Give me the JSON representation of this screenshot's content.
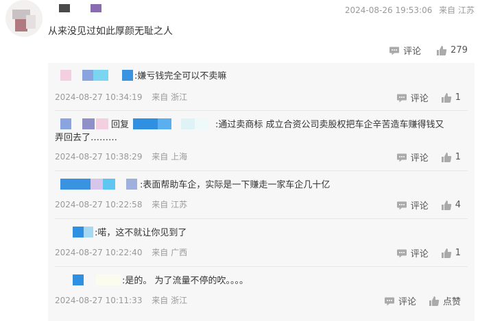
{
  "colors": {
    "text": "#333333",
    "meta": "#999999",
    "reply_bg": "#f7f7f7",
    "icon": "#aaaaaa"
  },
  "icons": {
    "comment": "comment-bubble-icon",
    "like": "thumbs-up-icon"
  },
  "main_comment": {
    "time": "2024-08-26 19:53:06",
    "location": "来自 江苏",
    "text": "从来没见过如此厚颜无耻之人",
    "comment_label": "评论",
    "like_count": "279"
  },
  "replies": [
    {
      "text": ":嫌亏钱完全可以不卖嘛",
      "time": "2024-08-27 10:34:19",
      "location": "来自 浙江",
      "comment_label": "评论",
      "like_count": "1"
    },
    {
      "reply_word": "回复",
      "text": ":通过卖商标 成立合资公司卖股权把车企辛苦造车赚得钱又",
      "text2": "弄回去了………",
      "time": "2024-08-27 10:38:29",
      "location": "来自 上海",
      "comment_label": "评论",
      "like_count": "1"
    },
    {
      "text": ":表面帮助车企，实际是一下赚走一家车企几十亿",
      "time": "2024-08-27 10:22:58",
      "location": "来自 江苏",
      "comment_label": "评论",
      "like_count": "4"
    },
    {
      "text": ":喏，这不就让你见到了",
      "time": "2024-08-27 10:22:40",
      "location": "来自 广西",
      "comment_label": "评论",
      "like_count": "1"
    },
    {
      "text": ":是的。 为了流量不停的吹。。。。",
      "time": "2024-08-27 10:11:33",
      "location": "来自 浙江",
      "comment_label": "评论",
      "like_count": "点赞"
    }
  ]
}
